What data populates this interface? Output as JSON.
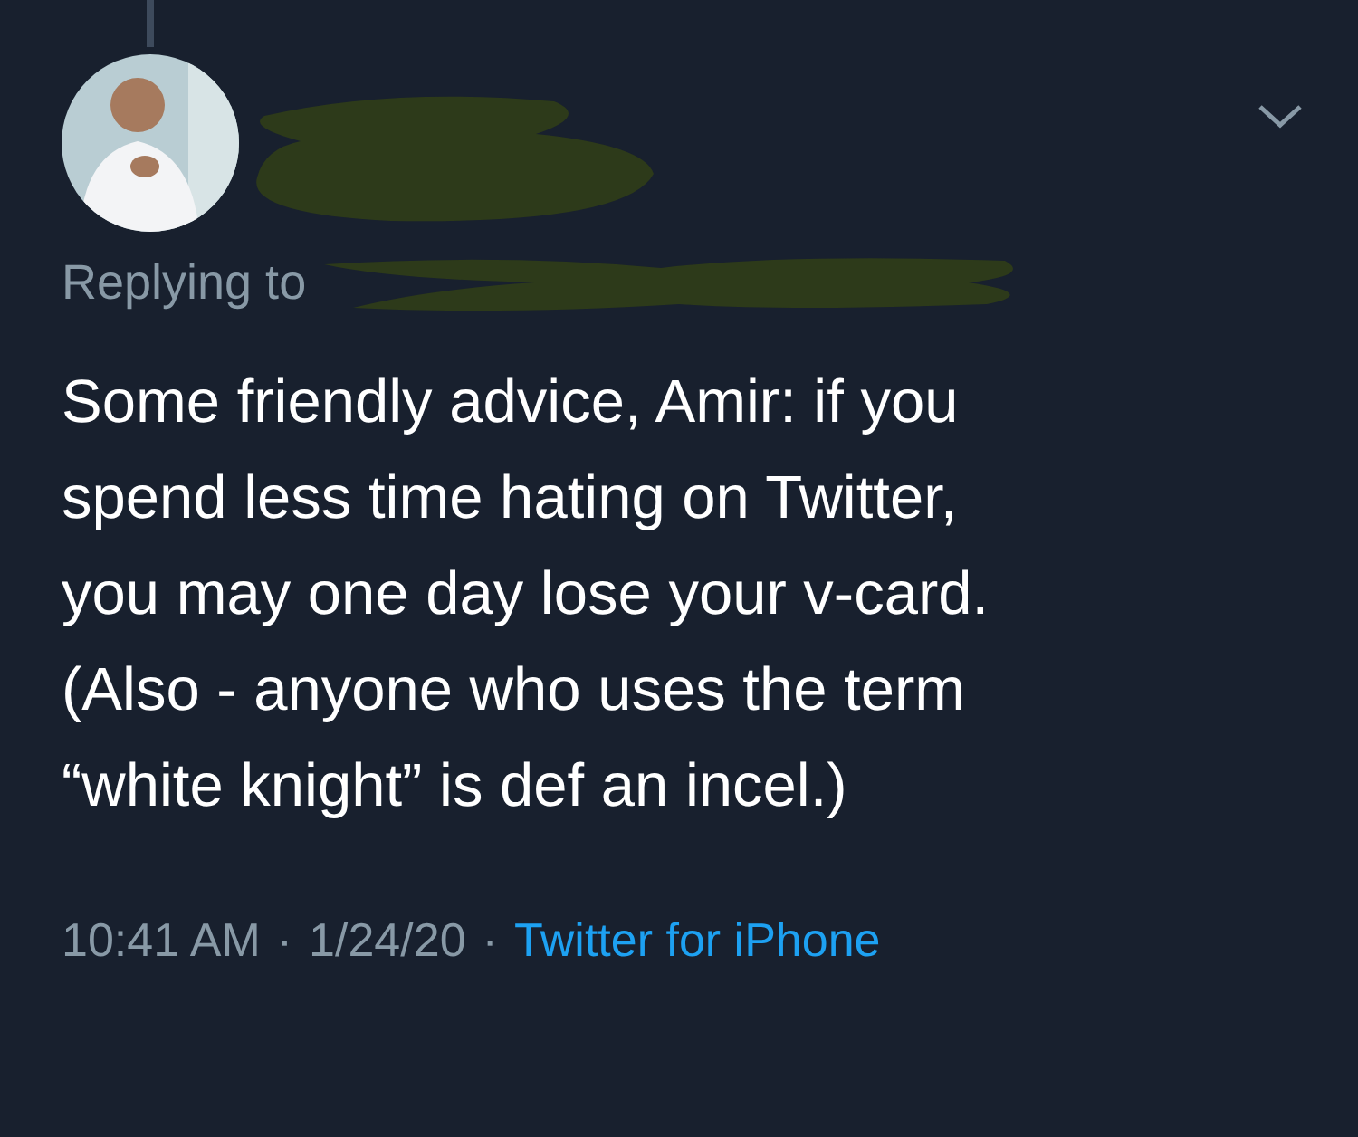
{
  "tweet": {
    "replying_label": "Replying to",
    "text": "Some friendly advice, Amir: if you\nspend less time hating on Twitter,\nyou may one day lose your v-card.\n(Also - anyone who uses the term\n“white knight” is def an incel.)",
    "time": "10:41 AM",
    "separator": "·",
    "date": "1/24/20",
    "separator_2": "·",
    "source": "Twitter for iPhone"
  }
}
